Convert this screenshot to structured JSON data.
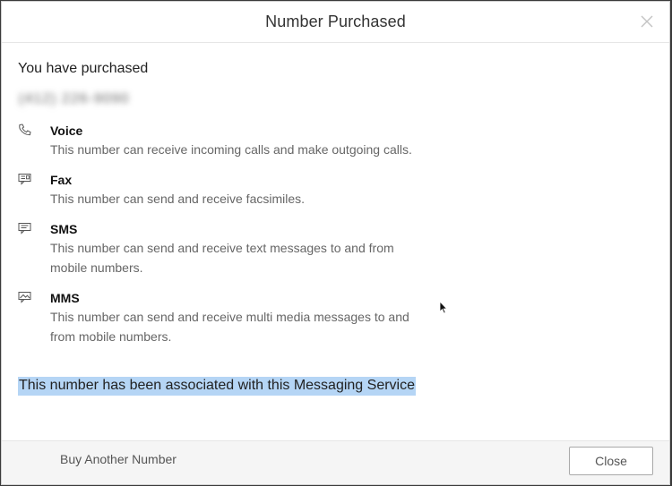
{
  "modal": {
    "title": "Number Purchased",
    "close_icon": "close-icon"
  },
  "content": {
    "purchased_label": "You have purchased",
    "phone_number": "(412) 226-9090",
    "capabilities": [
      {
        "icon": "phone-icon",
        "name": "Voice",
        "description": "This number can receive incoming calls and make outgoing calls."
      },
      {
        "icon": "fax-icon",
        "name": "Fax",
        "description": "This number can send and receive facsimiles."
      },
      {
        "icon": "chat-bubble-icon",
        "name": "SMS",
        "description": "This number can send and receive text messages to and from mobile numbers."
      },
      {
        "icon": "image-message-icon",
        "name": "MMS",
        "description": "This number can send and receive multi media messages to and from mobile numbers."
      }
    ],
    "association_message": "This number has been associated with this Messaging Service"
  },
  "footer": {
    "buy_another_label": "Buy Another Number",
    "close_label": "Close"
  },
  "colors": {
    "highlight": "#b5d5f5",
    "footer_bg": "#f5f5f5"
  }
}
